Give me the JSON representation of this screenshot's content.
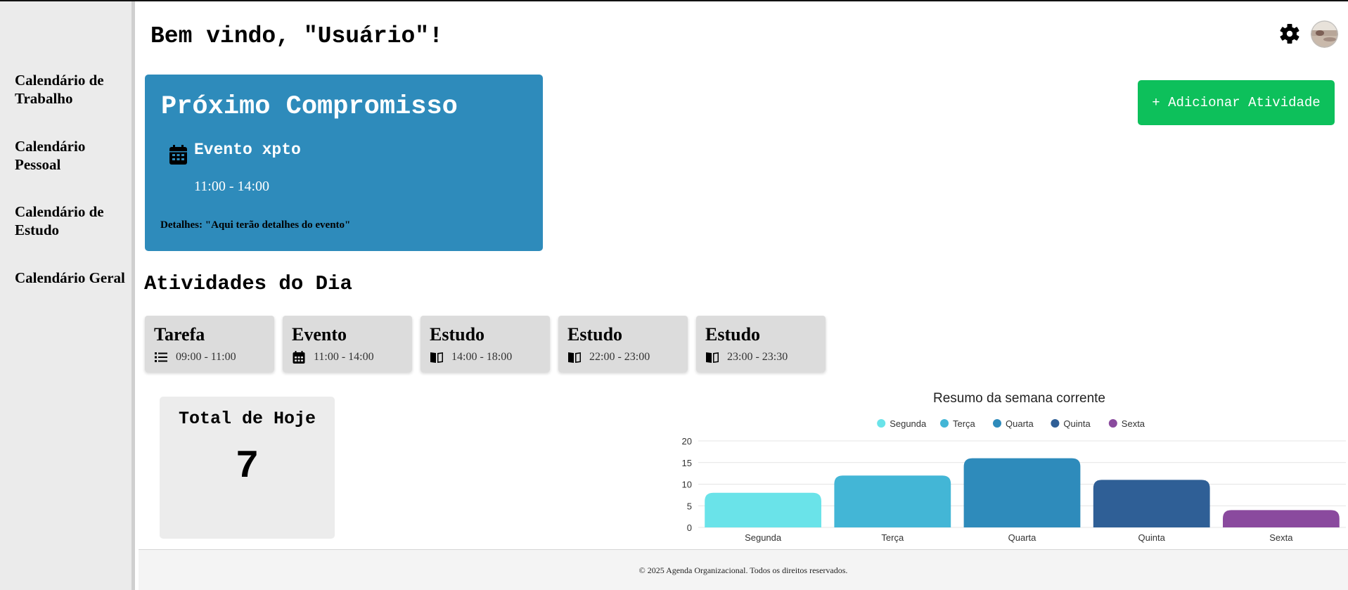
{
  "header": {
    "welcome": "Bem vindo, \"Usuário\"!"
  },
  "sidebar": {
    "items": [
      {
        "label": "Calendário de Trabalho"
      },
      {
        "label": "Calendário Pessoal"
      },
      {
        "label": "Calendário de Estudo"
      },
      {
        "label": "Calendário Geral"
      }
    ]
  },
  "next_appointment": {
    "title": "Próximo Compromisso",
    "event": "Evento xpto",
    "time": "11:00 - 14:00",
    "details": "Detalhes: \"Aqui terão detalhes do evento\"",
    "color": "#2e8bbb"
  },
  "add_button": {
    "label": "+ Adicionar Atividade",
    "color": "#0dc05b"
  },
  "activities": {
    "title": "Atividades do Dia",
    "items": [
      {
        "name": "Tarefa",
        "time": "09:00 - 11:00",
        "icon": "list-icon"
      },
      {
        "name": "Evento",
        "time": "11:00 - 14:00",
        "icon": "calendar-icon"
      },
      {
        "name": "Estudo",
        "time": "14:00 - 18:00",
        "icon": "book-icon"
      },
      {
        "name": "Estudo",
        "time": "22:00 - 23:00",
        "icon": "book-icon"
      },
      {
        "name": "Estudo",
        "time": "23:00 - 23:30",
        "icon": "book-icon"
      }
    ]
  },
  "total": {
    "label": "Total de Hoje",
    "value": "7"
  },
  "chart_data": {
    "type": "bar",
    "title": "Resumo da semana corrente",
    "categories": [
      "Segunda",
      "Terça",
      "Quarta",
      "Quinta",
      "Sexta"
    ],
    "values": [
      8,
      12,
      16,
      11,
      4
    ],
    "colors": [
      "#6ae3e9",
      "#43b6d6",
      "#2e8bbb",
      "#2f5f96",
      "#8a4a9e"
    ],
    "legend": [
      "Segunda",
      "Terça",
      "Quarta",
      "Quinta",
      "Sexta"
    ],
    "legend_position": "top",
    "ylim": [
      0,
      20
    ],
    "yticks": [
      0,
      5,
      10,
      15,
      20
    ],
    "grid": true
  },
  "footer": {
    "text": "© 2025 Agenda Organizacional. Todos os direitos reservados."
  }
}
